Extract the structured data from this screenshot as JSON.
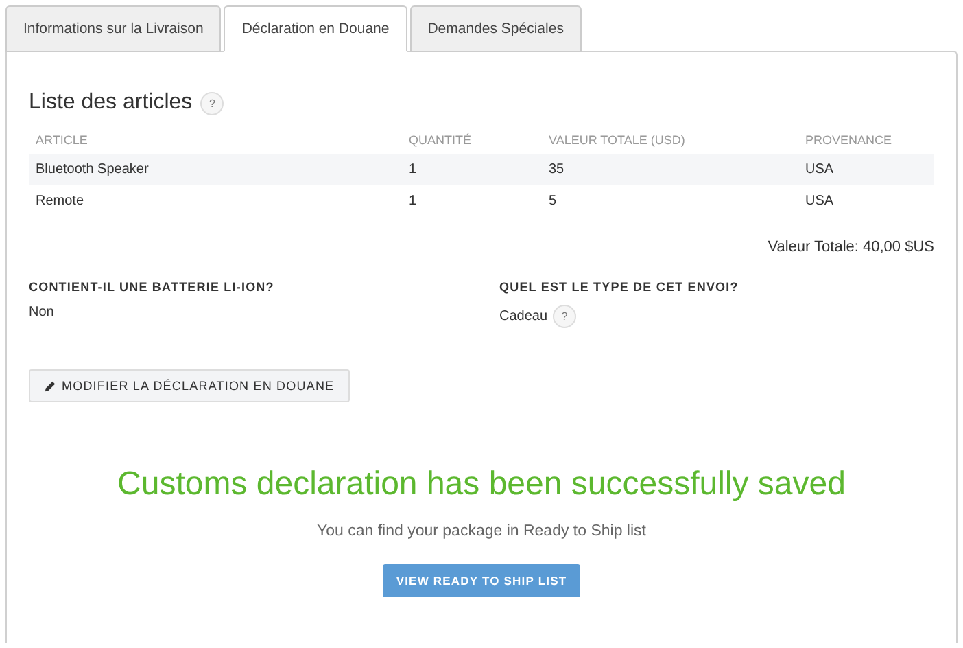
{
  "tabs": [
    {
      "label": "Informations sur la Livraison",
      "selected": false
    },
    {
      "label": "Déclaration en Douane",
      "selected": true
    },
    {
      "label": "Demandes Spéciales",
      "selected": false
    }
  ],
  "items": {
    "title": "Liste des articles",
    "help": "?",
    "columns": [
      "ARTICLE",
      "QUANTITÉ",
      "VALEUR TOTALE (USD)",
      "PROVENANCE"
    ],
    "rows": [
      [
        "Bluetooth Speaker",
        "1",
        "35",
        "USA"
      ],
      [
        "Remote",
        "1",
        "5",
        "USA"
      ]
    ],
    "total": "Valeur Totale: 40,00 $US"
  },
  "fields": [
    {
      "label": "CONTIENT-IL UNE BATTERIE LI-ION?",
      "value": "Non"
    },
    {
      "label": "QUEL EST LE TYPE DE CET ENVOI?",
      "value": "Cadeau",
      "help": "?"
    }
  ],
  "edit_button": "MODIFIER LA DÉCLARATION EN DOUANE",
  "success": {
    "message": "Customs declaration has been successfully saved",
    "hint": "You can find your package in Ready to Ship list",
    "button": "VIEW READY TO SHIP LIST"
  }
}
